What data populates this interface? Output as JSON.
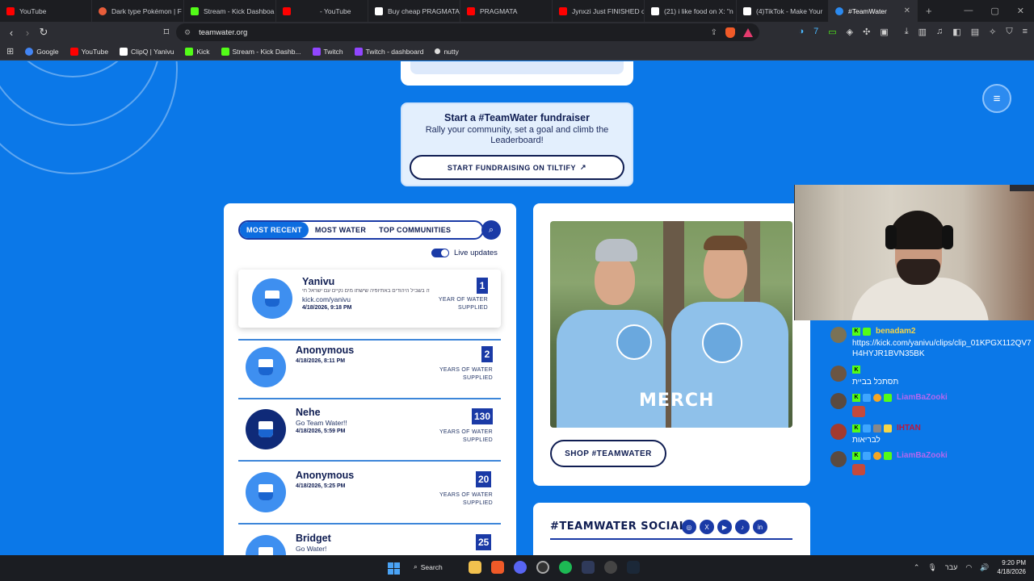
{
  "browser": {
    "tabs": [
      {
        "title": "YouTube",
        "color": "#ff0000"
      },
      {
        "title": "Dark type Pokémon | F",
        "color": "#e85d3a"
      },
      {
        "title": "Stream - Kick Dashboa",
        "color": "#53fc18"
      },
      {
        "title": "- YouTube",
        "color": "#ff0000"
      },
      {
        "title": "Buy cheap PRAGMATA",
        "color": "#ffffff"
      },
      {
        "title": "PRAGMATA",
        "color": "#ff0000"
      },
      {
        "title": "Jynxzi Just FINISHED o",
        "color": "#ff0000"
      },
      {
        "title": "(21) i like food on X: \"n",
        "color": "#ffffff"
      },
      {
        "title": "(4)TikTok - Make Your",
        "color": "#ffffff"
      },
      {
        "title": "#TeamWater",
        "color": "#2b8af0",
        "active": true
      }
    ],
    "url": "teamwater.org",
    "bookmarks": [
      {
        "label": "Google",
        "color": "#4285f4"
      },
      {
        "label": "YouTube",
        "color": "#ff0000"
      },
      {
        "label": "ClipQ | Yanivu",
        "color": "#ffffff"
      },
      {
        "label": "Kick",
        "color": "#53fc18"
      },
      {
        "label": "Stream - Kick Dashb...",
        "color": "#53fc18"
      },
      {
        "label": "Twitch",
        "color": "#9146ff"
      },
      {
        "label": "Twitch - dashboard",
        "color": "#9146ff"
      },
      {
        "label": "nutty",
        "color": "#dddddd"
      }
    ]
  },
  "fundraiser": {
    "title": "Start a #TeamWater fundraiser",
    "text": "Rally your community, set a goal and climb the Leaderboard!",
    "button": "START FUNDRAISING ON TILTIFY"
  },
  "leaderboard": {
    "tabs": [
      "MOST RECENT",
      "MOST WATER",
      "TOP COMMUNITIES"
    ],
    "live_label": "Live updates",
    "entries": [
      {
        "name": "Yanivu",
        "message": "זה בשביל היהודים באתיופיה שישתו מים נקיים עם ישראל חי",
        "message2": "kick.com/yanivu",
        "date": "4/18/2026, 9:18 PM",
        "amount": "1",
        "unit": "YEAR OF WATER SUPPLIED"
      },
      {
        "name": "Anonymous",
        "message": "",
        "message2": "",
        "date": "4/18/2026, 8:11 PM",
        "amount": "2",
        "unit": "YEARS OF WATER SUPPLIED"
      },
      {
        "name": "Nehe",
        "message": "Go Team Water!!",
        "message2": "",
        "date": "4/18/2026, 5:59 PM",
        "amount": "130",
        "unit": "YEARS OF WATER SUPPLIED"
      },
      {
        "name": "Anonymous",
        "message": "",
        "message2": "",
        "date": "4/18/2026, 5:25 PM",
        "amount": "20",
        "unit": "YEARS OF WATER SUPPLIED"
      },
      {
        "name": "Bridget",
        "message": "Go Water!",
        "message2": "",
        "date": "",
        "amount": "25",
        "unit": ""
      }
    ]
  },
  "merch": {
    "overlay": "MERCH",
    "button": "SHOP #TEAMWATER"
  },
  "social": {
    "title": "#TEAMWATER SOCIAL",
    "icons": [
      "instagram-icon",
      "x-icon",
      "youtube-icon",
      "tiktok-icon",
      "linkedin-icon"
    ],
    "glyphs": [
      "◎",
      "X",
      "▶",
      "♪",
      "in"
    ]
  },
  "chat": {
    "messages": [
      {
        "user": "benadam2",
        "user_color": "#f5d547",
        "text": "https://kick.com/yanivu/clips/clip_01KPGX112QV7H4HYJR1BVN35BK"
      },
      {
        "user": "",
        "user_color": "#444444",
        "text": "תסתכל בביית"
      },
      {
        "user": "LiamBaZooki",
        "user_color": "#b467f0",
        "text": ""
      },
      {
        "user": "IHTAN",
        "user_color": "#c0163a",
        "text": "לבריאות"
      },
      {
        "user": "LiamBaZooki",
        "user_color": "#b467f0",
        "text": ""
      }
    ]
  },
  "taskbar": {
    "search": "Search",
    "lang": "עבר",
    "time": "9:20 PM",
    "date": "4/18/2026"
  }
}
